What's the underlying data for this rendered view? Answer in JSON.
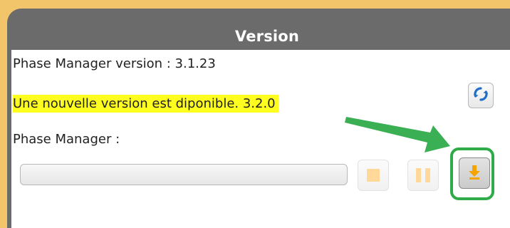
{
  "panel": {
    "title": "Version"
  },
  "info": {
    "version_line": "Phase Manager version :  3.1.23",
    "update_notice": "Une nouvelle version est diponible. 3.2.0",
    "component_label": "Phase Manager :"
  },
  "buttons": {
    "refresh_icon": "refresh-icon",
    "stop_icon": "stop-icon",
    "pause_icon": "pause-icon",
    "download_icon": "download-icon"
  },
  "progress": {
    "value": 0
  },
  "colors": {
    "background": "#f2c56b",
    "header": "#6b6b6b",
    "highlight": "#ffff1f",
    "accent_orange": "#f4a300",
    "refresh_blue": "#1f6ec8",
    "annotation_green": "#2fab4a"
  }
}
